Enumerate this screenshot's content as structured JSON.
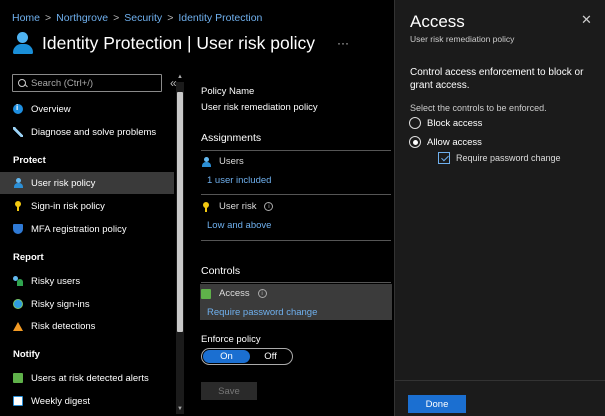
{
  "breadcrumb": [
    "Home",
    "Northgrove",
    "Security",
    "Identity Protection"
  ],
  "page_title": "Identity Protection | User risk policy",
  "more": "···",
  "sidebar": {
    "search_placeholder": "Search (Ctrl+/)",
    "collapse": "«",
    "items": [
      {
        "label": "Overview",
        "icon": "info-icon"
      },
      {
        "label": "Diagnose and solve problems",
        "icon": "wrench-icon"
      }
    ],
    "sections": [
      {
        "title": "Protect",
        "items": [
          {
            "label": "User risk policy",
            "icon": "user-icon",
            "selected": true
          },
          {
            "label": "Sign-in risk policy",
            "icon": "key-icon"
          },
          {
            "label": "MFA registration policy",
            "icon": "shield-icon"
          }
        ]
      },
      {
        "title": "Report",
        "items": [
          {
            "label": "Risky users",
            "icon": "risky-users-icon"
          },
          {
            "label": "Risky sign-ins",
            "icon": "globe-icon"
          },
          {
            "label": "Risk detections",
            "icon": "warning-icon"
          }
        ]
      },
      {
        "title": "Notify",
        "items": [
          {
            "label": "Users at risk detected alerts",
            "icon": "alert-icon"
          },
          {
            "label": "Weekly digest",
            "icon": "digest-icon"
          }
        ]
      }
    ]
  },
  "main": {
    "policy_name_label": "Policy Name",
    "policy_name_value": "User risk remediation policy",
    "assignments_heading": "Assignments",
    "users_label": "Users",
    "users_link": "1 user included",
    "user_risk_label": "User risk",
    "user_risk_link": "Low and above",
    "controls_heading": "Controls",
    "access_label": "Access",
    "access_link": "Require password change",
    "enforce_label": "Enforce policy",
    "toggle_on": "On",
    "toggle_off": "Off",
    "save_label": "Save"
  },
  "panel": {
    "title": "Access",
    "subtitle": "User risk remediation policy",
    "close": "✕",
    "description": "Control access enforcement to block or grant access.",
    "hint": "Select the controls to be enforced.",
    "options": [
      {
        "label": "Block access",
        "checked": false
      },
      {
        "label": "Allow access",
        "checked": true
      }
    ],
    "require_password_label": "Require password change",
    "done_label": "Done"
  },
  "colors": {
    "accent": "#1b6fd1",
    "link": "#6fb0ee",
    "background": "#000000",
    "panel_background": "#1b1b1b",
    "selected_row": "#3a3a3a"
  }
}
